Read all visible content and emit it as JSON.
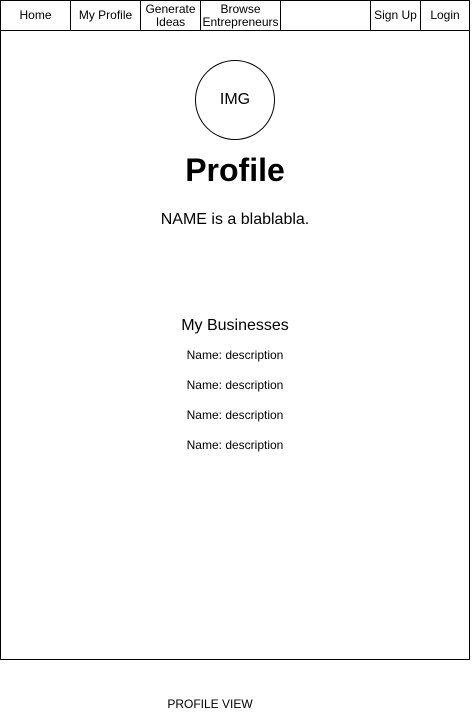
{
  "nav": {
    "home": "Home",
    "my_profile": "My Profile",
    "generate_ideas_line1": "Generate",
    "generate_ideas_line2": "Ideas",
    "browse_line1": "Browse",
    "browse_line2": "Entrepreneurs",
    "sign_up": "Sign Up",
    "login": "Login"
  },
  "profile": {
    "avatar_text": "IMG",
    "title": "Profile",
    "bio": "NAME is a blablabla."
  },
  "businesses": {
    "heading": "My Businesses",
    "items": [
      "Name: description",
      "Name: description",
      "Name: description",
      "Name: description"
    ]
  },
  "caption": "PROFILE VIEW"
}
